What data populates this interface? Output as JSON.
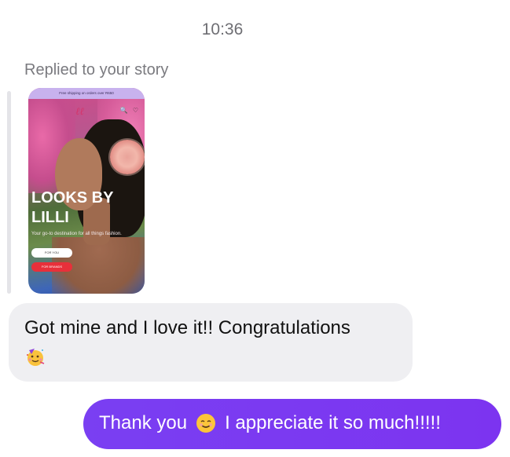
{
  "thread": {
    "timestamp": "10:36",
    "reply_label": "Replied to your story"
  },
  "story": {
    "banner": "Free shipping on orders over R650",
    "logo": "ℓℓ",
    "icons": "🔍 ♡",
    "title_line1": "LOOKS BY",
    "title_line2": "LILLI",
    "subtitle": "Your go-to destination for all things fashion.",
    "button1": "FOR YOU",
    "button2": "FOR BRANDS"
  },
  "messages": {
    "received_text": "Got mine and I love it!! Congratulations",
    "received_emoji": "partying-face-emoji",
    "sent_text_before": "Thank you",
    "sent_emoji": "smiling-face-emoji",
    "sent_text_after": "I appreciate it so much!!!!!"
  },
  "colors": {
    "sent_bubble": "#7b3af3",
    "received_bubble": "#efeff2"
  }
}
